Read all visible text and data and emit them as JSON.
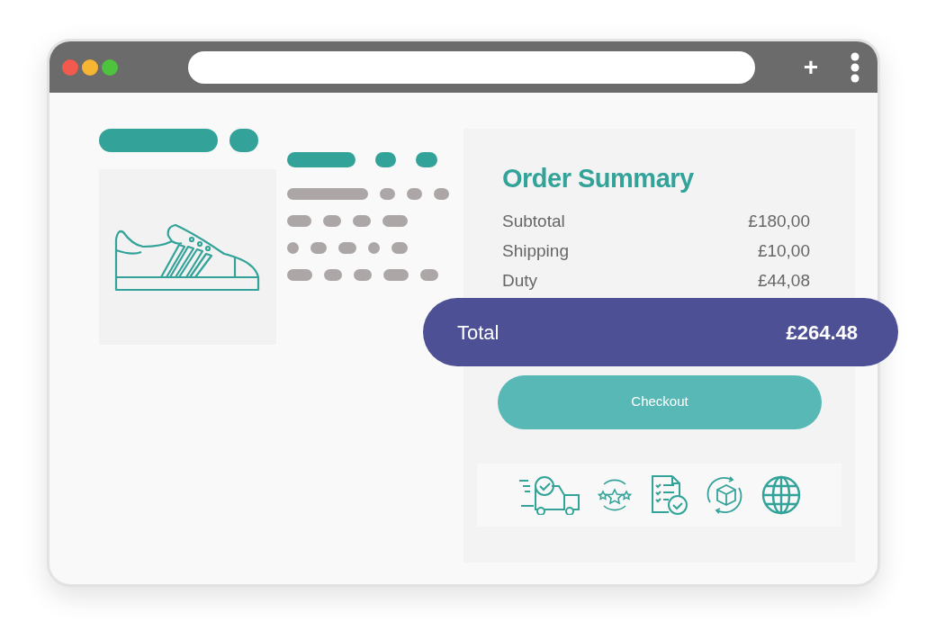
{
  "order_summary": {
    "title": "Order Summary",
    "rows": [
      {
        "label": "Subtotal",
        "value": "£180,00"
      },
      {
        "label": "Shipping",
        "value": "£10,00"
      },
      {
        "label": "Duty",
        "value": "£44,08"
      }
    ],
    "total": {
      "label": "Total",
      "value": "£264.48"
    },
    "checkout_button": "Checkout"
  },
  "toolbar": {
    "new_tab": "+"
  }
}
